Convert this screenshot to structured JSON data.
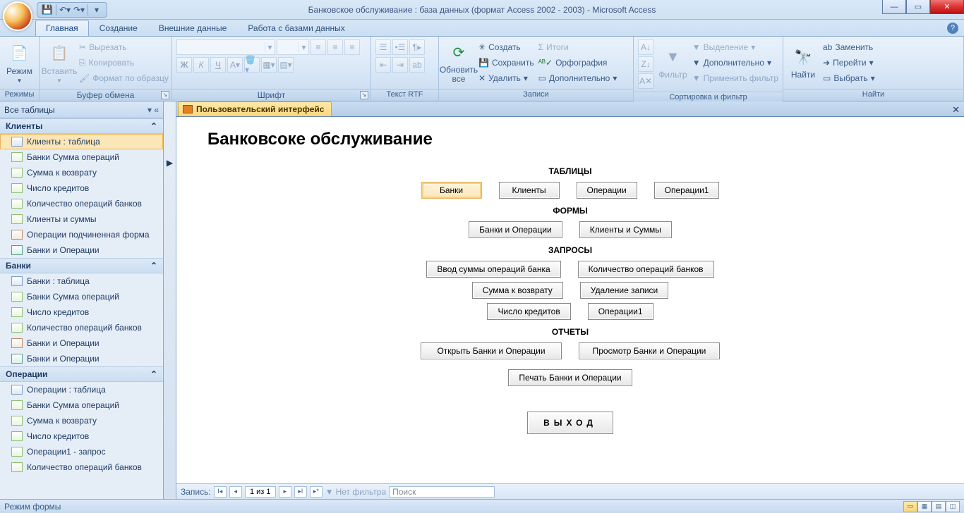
{
  "titlebar": {
    "title": "Банковское обслуживание : база данных (формат Access 2002 - 2003) - Microsoft Access"
  },
  "ribbon_tabs": {
    "items": [
      "Главная",
      "Создание",
      "Внешние данные",
      "Работа с базами данных"
    ],
    "active_index": 0
  },
  "ribbon": {
    "modes": {
      "label": "Режим",
      "group": "Режимы"
    },
    "clipboard": {
      "paste": "Вставить",
      "cut": "Вырезать",
      "copy": "Копировать",
      "format_painter": "Формат по образцу",
      "group": "Буфер обмена"
    },
    "font": {
      "group": "Шрифт",
      "bold": "Ж",
      "italic": "К",
      "underline": "Ч"
    },
    "richtext": {
      "group": "Текст RTF"
    },
    "records": {
      "refresh": "Обновить все",
      "new": "Создать",
      "save": "Сохранить",
      "delete": "Удалить",
      "totals": "Итоги",
      "spelling": "Орфография",
      "more": "Дополнительно",
      "group": "Записи"
    },
    "sortfilter": {
      "filter": "Фильтр",
      "selection": "Выделение",
      "advanced": "Дополнительно",
      "toggle": "Применить фильтр",
      "group": "Сортировка и фильтр"
    },
    "find": {
      "find": "Найти",
      "replace": "Заменить",
      "goto": "Перейти",
      "select": "Выбрать",
      "group": "Найти"
    }
  },
  "navpane": {
    "header": "Все таблицы",
    "groups": [
      {
        "name": "Клиенты",
        "items": [
          {
            "icon": "table",
            "label": "Клиенты : таблица",
            "selected": true
          },
          {
            "icon": "query",
            "label": "Банки Сумма операций"
          },
          {
            "icon": "query",
            "label": "Сумма к возврату"
          },
          {
            "icon": "query",
            "label": "Число кредитов"
          },
          {
            "icon": "query",
            "label": "Количество операций банков"
          },
          {
            "icon": "query",
            "label": "Клиенты и суммы"
          },
          {
            "icon": "form",
            "label": "Операции подчиненная форма"
          },
          {
            "icon": "report",
            "label": "Банки и Операции"
          }
        ]
      },
      {
        "name": "Банки",
        "items": [
          {
            "icon": "table",
            "label": "Банки : таблица"
          },
          {
            "icon": "query",
            "label": "Банки Сумма операций"
          },
          {
            "icon": "query",
            "label": "Число кредитов"
          },
          {
            "icon": "query",
            "label": "Количество операций банков"
          },
          {
            "icon": "form",
            "label": "Банки и Операции"
          },
          {
            "icon": "report",
            "label": "Банки и Операции"
          }
        ]
      },
      {
        "name": "Операции",
        "items": [
          {
            "icon": "table",
            "label": "Операции : таблица"
          },
          {
            "icon": "query",
            "label": "Банки Сумма операций"
          },
          {
            "icon": "query",
            "label": "Сумма к возврату"
          },
          {
            "icon": "query",
            "label": "Число кредитов"
          },
          {
            "icon": "query",
            "label": "Операции1 - запрос"
          },
          {
            "icon": "query",
            "label": "Количество операций банков"
          }
        ]
      }
    ]
  },
  "document": {
    "tab_title": "Пользовательский интерфейс",
    "form_title": "Банковсоке обслуживание",
    "sections": {
      "tables": {
        "heading": "ТАБЛИЦЫ",
        "buttons": [
          "Банки",
          "Клиенты",
          "Операции",
          "Операции1"
        ],
        "selected_index": 0
      },
      "forms": {
        "heading": "ФОРМЫ",
        "buttons": [
          "Банки и Операции",
          "Клиенты и Суммы"
        ]
      },
      "queries": {
        "heading": "ЗАПРОСЫ",
        "rows": [
          [
            "Ввод суммы операций банка",
            "Количество операций банков"
          ],
          [
            "Сумма к возврату",
            "Удаление записи"
          ],
          [
            "Число кредитов",
            "Операции1"
          ]
        ]
      },
      "reports": {
        "heading": "ОТЧЕТЫ",
        "row1": [
          "Открыть Банки и Операции",
          "Просмотр Банки и Операции"
        ],
        "row2": [
          "Печать Банки и Операции"
        ]
      },
      "exit": "ВЫХОД"
    }
  },
  "recordnav": {
    "label": "Запись:",
    "current": "1 из 1",
    "no_filter": "Нет фильтра",
    "search": "Поиск"
  },
  "statusbar": {
    "text": "Режим формы"
  }
}
